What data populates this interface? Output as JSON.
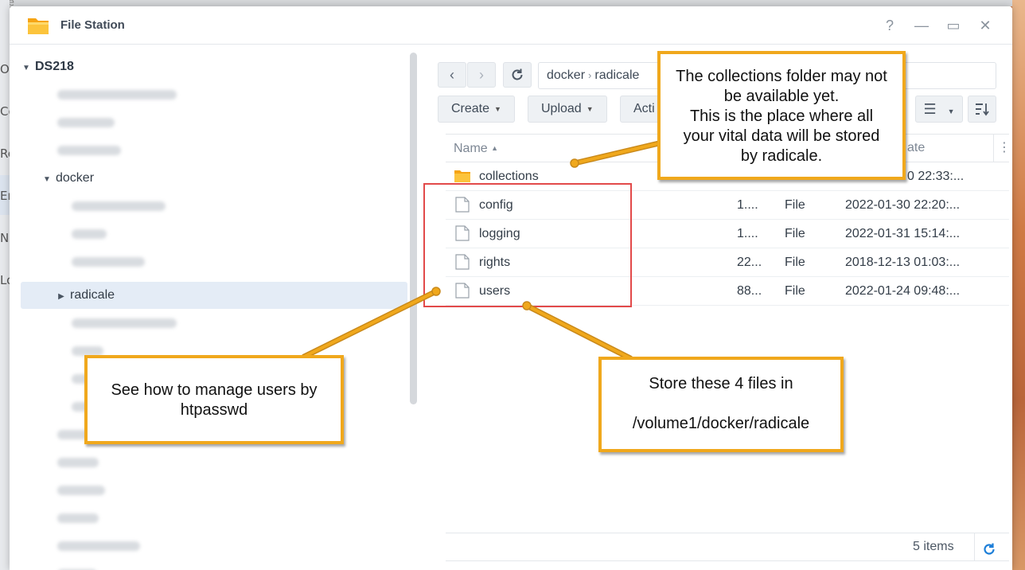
{
  "window": {
    "title": "File Station",
    "help": "?",
    "minimize": "—",
    "maximize": "▭",
    "close": "✕"
  },
  "desktop": {
    "fragments": [
      "De",
      "Ov",
      "Co",
      "Re",
      "En",
      "Ne",
      "Lo"
    ]
  },
  "tree": {
    "root": "DS218",
    "items": [
      {
        "label": "docker",
        "expanded": true
      },
      {
        "label": "radicale",
        "selected": true
      }
    ]
  },
  "toolbar": {
    "back": "‹",
    "forward": "›",
    "refresh": "⟳",
    "path": [
      "docker",
      "radicale"
    ],
    "create": "Create",
    "upload": "Upload",
    "action": "Acti"
  },
  "table": {
    "headers": {
      "name": "Name",
      "date": "ate"
    },
    "rows": [
      {
        "name": "collections",
        "type": "folder",
        "size": "",
        "kind": "",
        "date": "0 22:33:..."
      },
      {
        "name": "config",
        "type": "file",
        "size": "1....",
        "kind": "File",
        "date": "2022-01-30 22:20:..."
      },
      {
        "name": "logging",
        "type": "file",
        "size": "1....",
        "kind": "File",
        "date": "2022-01-31 15:14:..."
      },
      {
        "name": "rights",
        "type": "file",
        "size": "22...",
        "kind": "File",
        "date": "2018-12-13 01:03:..."
      },
      {
        "name": "users",
        "type": "file",
        "size": "88...",
        "kind": "File",
        "date": "2022-01-24 09:48:..."
      }
    ],
    "footer": "5 items"
  },
  "annotations": {
    "top": [
      "The collections folder may not",
      "be available yet.",
      "This is the place where all",
      "your vital data will be stored",
      "by radicale."
    ],
    "left": [
      "See how to manage users by",
      "htpasswd"
    ],
    "right": [
      "Store these 4 files in",
      "/volume1/docker/radicale"
    ]
  },
  "colors": {
    "callout_border": "#f0a81c",
    "highlight_box": "#e24a4a",
    "selection": "#e4ecf6",
    "refresh_accent": "#1e7fd8"
  }
}
